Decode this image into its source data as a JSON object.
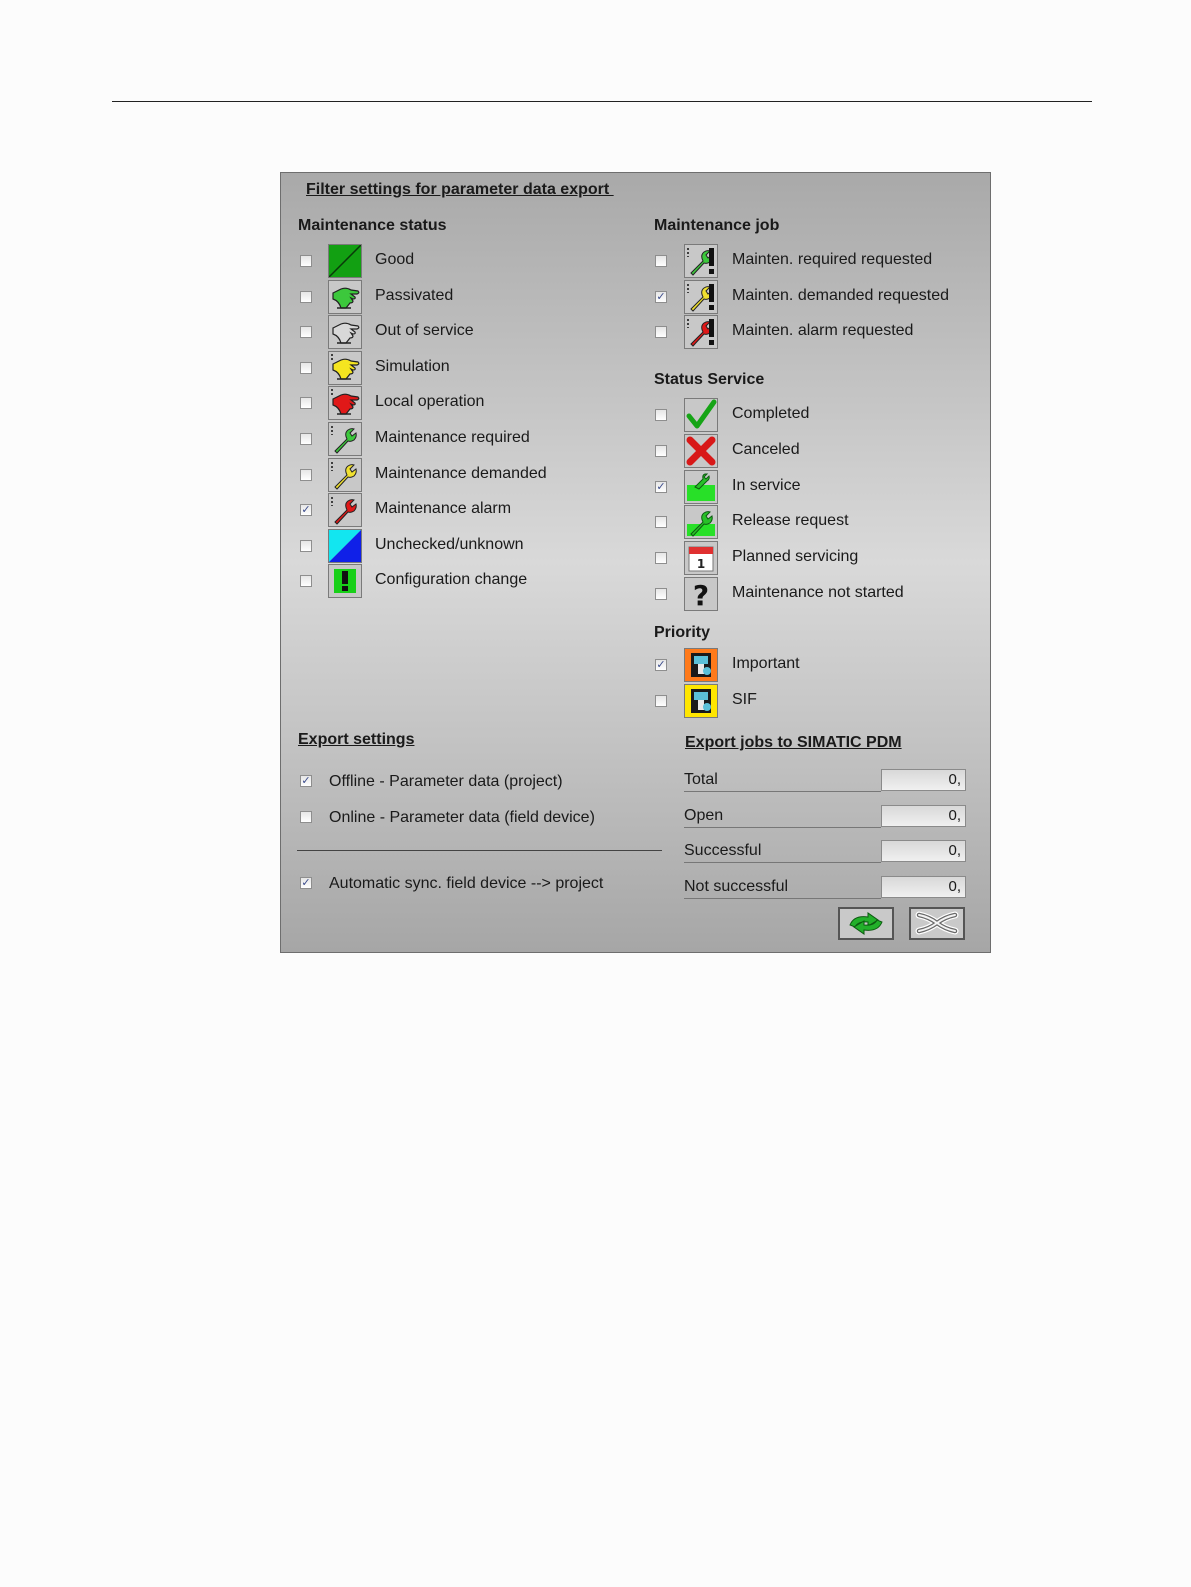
{
  "dialog": {
    "title": "Filter settings for parameter data export ",
    "maintenance_status": {
      "heading": "Maintenance status",
      "items": [
        {
          "label": "Good",
          "checked": false,
          "icon": "good-icon"
        },
        {
          "label": "Passivated",
          "checked": false,
          "icon": "passivated-hand-icon"
        },
        {
          "label": "Out of service",
          "checked": false,
          "icon": "out-of-service-hand-icon"
        },
        {
          "label": "Simulation",
          "checked": false,
          "icon": "simulation-hand-icon"
        },
        {
          "label": "Local operation",
          "checked": false,
          "icon": "local-operation-hand-icon"
        },
        {
          "label": "Maintenance required",
          "checked": false,
          "icon": "wrench-green-icon"
        },
        {
          "label": "Maintenance demanded",
          "checked": false,
          "icon": "wrench-yellow-icon"
        },
        {
          "label": "Maintenance alarm",
          "checked": true,
          "icon": "wrench-red-icon"
        },
        {
          "label": "Unchecked/unknown",
          "checked": false,
          "icon": "unknown-icon"
        },
        {
          "label": "Configuration change",
          "checked": false,
          "icon": "exclamation-icon"
        }
      ]
    },
    "maintenance_job": {
      "heading": "Maintenance job",
      "items": [
        {
          "label": "Mainten. required requested",
          "checked": false,
          "icon": "wrench-green-exclamation-icon"
        },
        {
          "label": "Mainten. demanded requested",
          "checked": true,
          "icon": "wrench-yellow-exclamation-icon"
        },
        {
          "label": "Mainten. alarm requested",
          "checked": false,
          "icon": "wrench-red-exclamation-icon"
        }
      ]
    },
    "status_service": {
      "heading": "Status Service",
      "items": [
        {
          "label": "Completed",
          "checked": false,
          "icon": "checkmark-icon"
        },
        {
          "label": "Canceled",
          "checked": false,
          "icon": "red-x-icon"
        },
        {
          "label": "In service",
          "checked": true,
          "icon": "in-service-icon"
        },
        {
          "label": "Release request",
          "checked": false,
          "icon": "release-request-icon"
        },
        {
          "label": "Planned servicing",
          "checked": false,
          "icon": "calendar-icon"
        },
        {
          "label": "Maintenance not started",
          "checked": false,
          "icon": "question-mark-icon"
        }
      ]
    },
    "priority": {
      "heading": "Priority",
      "items": [
        {
          "label": "Important",
          "checked": true,
          "icon": "priority-orange-icon"
        },
        {
          "label": "SIF",
          "checked": false,
          "icon": "priority-yellow-icon"
        }
      ]
    },
    "export_settings": {
      "heading": "Export settings",
      "items": [
        {
          "label": "Offline - Parameter data (project)",
          "checked": true
        },
        {
          "label": "Online - Parameter data (field device)",
          "checked": false
        }
      ],
      "sync": {
        "label": "Automatic sync. field device --> project",
        "checked": true
      }
    },
    "export_jobs": {
      "heading": "Export jobs to SIMATIC PDM",
      "rows": [
        {
          "label": "Total",
          "value": "0,"
        },
        {
          "label": "Open",
          "value": "0,"
        },
        {
          "label": "Successful",
          "value": "0,"
        },
        {
          "label": "Not successful",
          "value": "0,"
        }
      ]
    },
    "buttons": {
      "refresh": "refresh-arrows-icon",
      "cancel": "cancel-x-icon"
    },
    "colors": {
      "good": "#12a012",
      "unknown_cyan": "#12e6f0",
      "unknown_blue": "#1020e8",
      "priority_orange": "#ff7a1a",
      "priority_yellow": "#ffe600"
    }
  }
}
